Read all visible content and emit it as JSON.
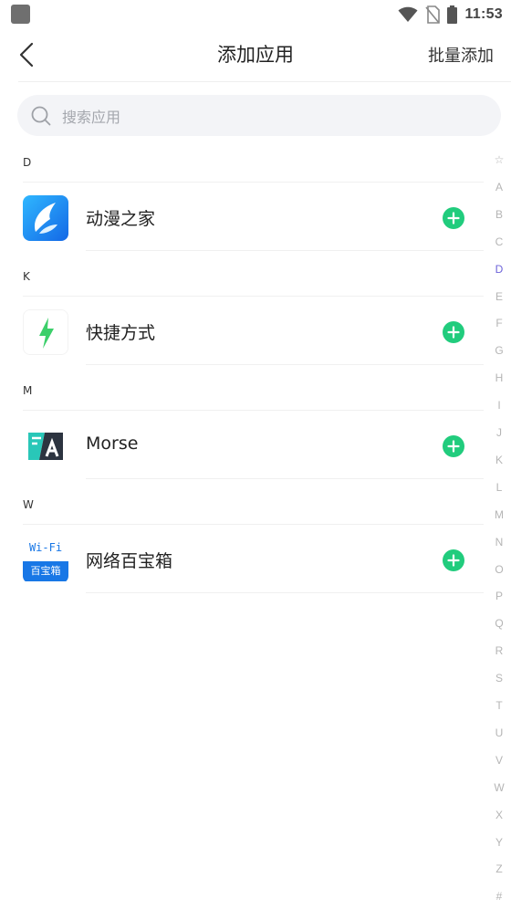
{
  "status_bar": {
    "time": "11:53"
  },
  "header": {
    "title": "添加应用",
    "batch_add": "批量添加"
  },
  "search": {
    "placeholder": "搜索应用"
  },
  "sections": [
    {
      "letter": "D",
      "apps": [
        {
          "name": "动漫之家",
          "icon": "anime-home-icon"
        }
      ]
    },
    {
      "letter": "K",
      "apps": [
        {
          "name": "快捷方式",
          "icon": "shortcut-lightning-icon"
        }
      ]
    },
    {
      "letter": "M",
      "apps": [
        {
          "name": "Morse",
          "icon": "morse-icon"
        }
      ]
    },
    {
      "letter": "W",
      "apps": [
        {
          "name": "网络百宝箱",
          "icon": "wifi-toolbox-icon",
          "icon_text_top": "Wi-Fi",
          "icon_text_bottom": "百宝箱"
        }
      ]
    }
  ],
  "index_bar": {
    "letters": [
      "☆",
      "A",
      "B",
      "C",
      "D",
      "E",
      "F",
      "G",
      "H",
      "I",
      "J",
      "K",
      "L",
      "M",
      "N",
      "O",
      "P",
      "Q",
      "R",
      "S",
      "T",
      "U",
      "V",
      "W",
      "X",
      "Y",
      "Z",
      "#"
    ],
    "active": "D"
  },
  "colors": {
    "accent_green": "#21cc7d",
    "index_active": "#6d63d9",
    "search_bg": "#f3f4f7"
  }
}
